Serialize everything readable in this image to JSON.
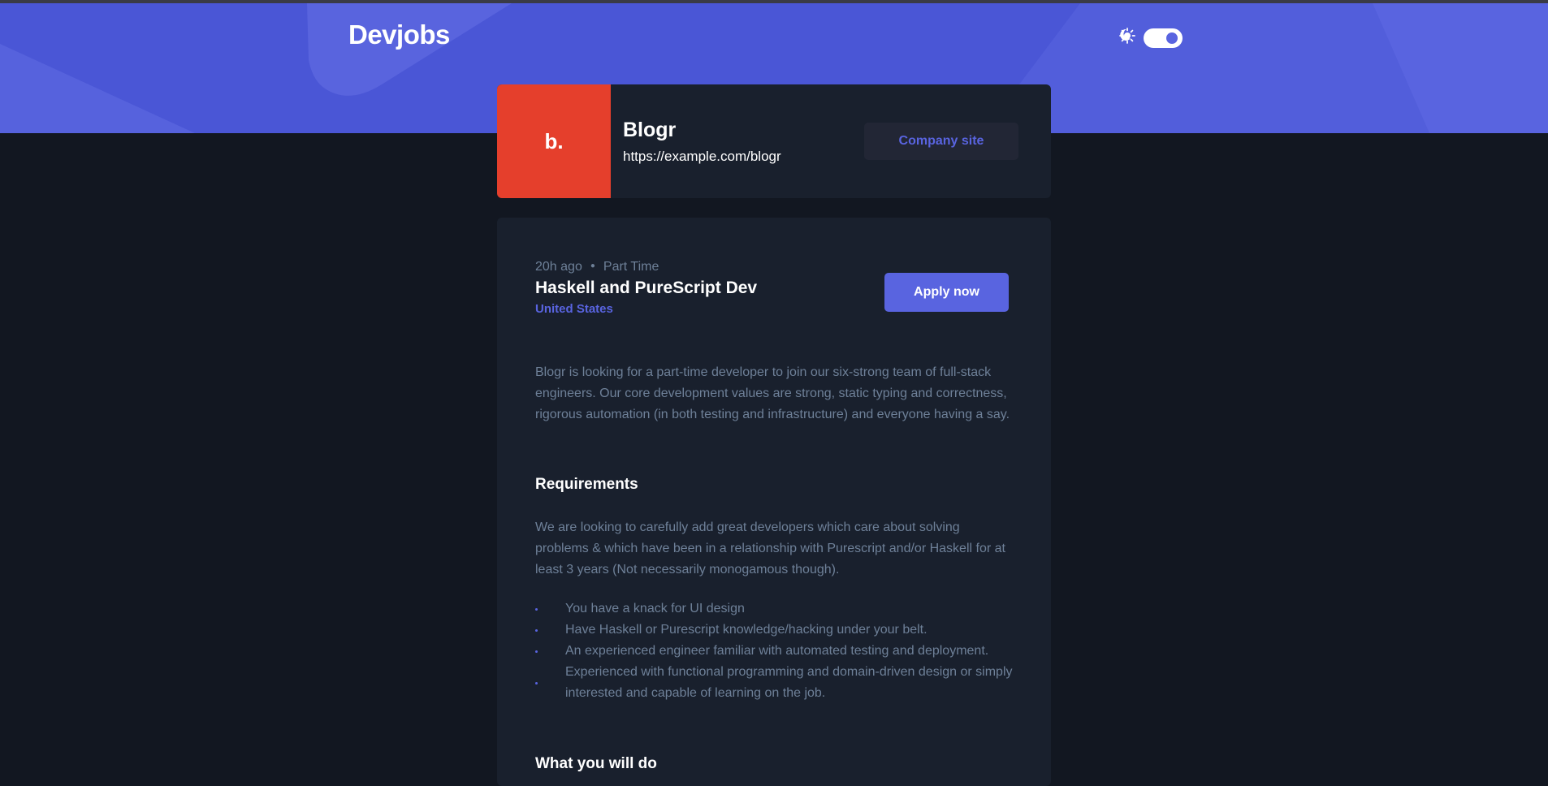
{
  "header": {
    "logo": "Devjobs",
    "theme_toggle": {
      "light_icon": "sun-icon",
      "dark_icon": "moon-icon",
      "state": "dark"
    }
  },
  "company": {
    "logo_text": "b.",
    "name": "Blogr",
    "url": "https://example.com/blogr",
    "site_button": "Company site",
    "logo_color": "#e53f2c"
  },
  "job": {
    "posted": "20h ago",
    "contract": "Part Time",
    "title": "Haskell and PureScript Dev",
    "location": "United States",
    "apply_button": "Apply now",
    "description": "Blogr is looking for a part-time developer to join our six-strong team of full-stack engineers. Our core development values are strong, static typing and correctness, rigorous automation (in both testing and infrastructure) and everyone having a say.",
    "requirements": {
      "heading": "Requirements",
      "content": "We are looking to carefully add great developers which care about solving problems & which have been in a relationship with Purescript and/or Haskell for at least 3 years (Not necessarily monogamous though).",
      "items": [
        "You have a knack for UI design",
        "Have Haskell or Purescript knowledge/hacking under your belt.",
        "An experienced engineer familiar with automated testing and deployment.",
        "Experienced with functional programming and domain-driven design or simply interested and capable of learning on the job."
      ]
    },
    "role": {
      "heading": "What you will do"
    }
  },
  "colors": {
    "accent": "#5964e0",
    "background": "#121721",
    "card": "#19202d",
    "muted_text": "#6e8098"
  }
}
